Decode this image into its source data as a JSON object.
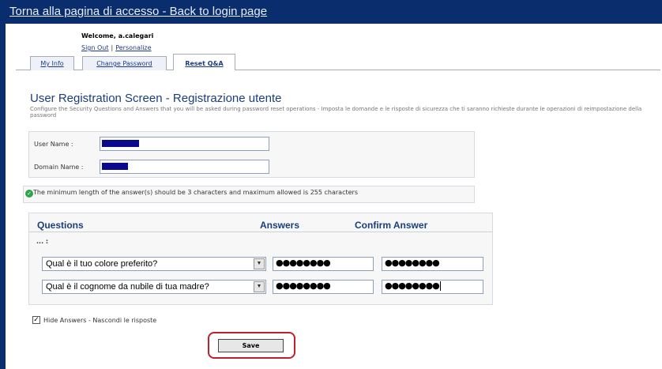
{
  "header": {
    "login_link": "Torna alla pagina di accesso - Back to login page"
  },
  "user": {
    "welcome": "Welcome,",
    "username": "a.calegari",
    "sign_out": "Sign Out",
    "separator": "|",
    "personalize": "Personalize"
  },
  "tabs": [
    {
      "label": "My Info",
      "active": false
    },
    {
      "label": "Change Password",
      "active": false
    },
    {
      "label": "Reset Q&A",
      "active": true
    }
  ],
  "page": {
    "title": "User Registration Screen - Registrazione utente",
    "description": "Configure the Security Questions and Answers that you will be asked during password reset operations - Imposta le domande e le risposte di sicurezza che ti saranno richieste durante le operazioni di reimpostazione della password"
  },
  "form": {
    "username_label": "User Name :",
    "domain_label": "Domain Name :",
    "hint": "The minimum length of the answer(s) should be 3 characters and maximum allowed is 255 characters",
    "questions_header": "Questions",
    "answers_header": "Answers",
    "confirm_header": "Confirm Answer",
    "question_group": "... :",
    "rows": [
      {
        "question": "Qual è il tuo colore preferito?",
        "answer": "●●●●●●●●",
        "confirm": "●●●●●●●●"
      },
      {
        "question": "Qual è il cognome da nubile di tua madre?",
        "answer": "●●●●●●●●",
        "confirm": "●●●●●●●●"
      }
    ],
    "hide_answers_label": "Hide Answers - Nascondi le risposte",
    "hide_answers_checked": true,
    "save_label": "Save"
  },
  "icons": {
    "ok": "check-circle-icon",
    "dropdown": "chevron-down-icon",
    "checkbox": "checkmark-icon"
  },
  "colors": {
    "navy": "#0a2d6e",
    "title_blue": "#1a3e7c",
    "ok_green": "#2ea44a",
    "highlight_red": "#c0202e",
    "redaction": "#0a0a8c"
  }
}
